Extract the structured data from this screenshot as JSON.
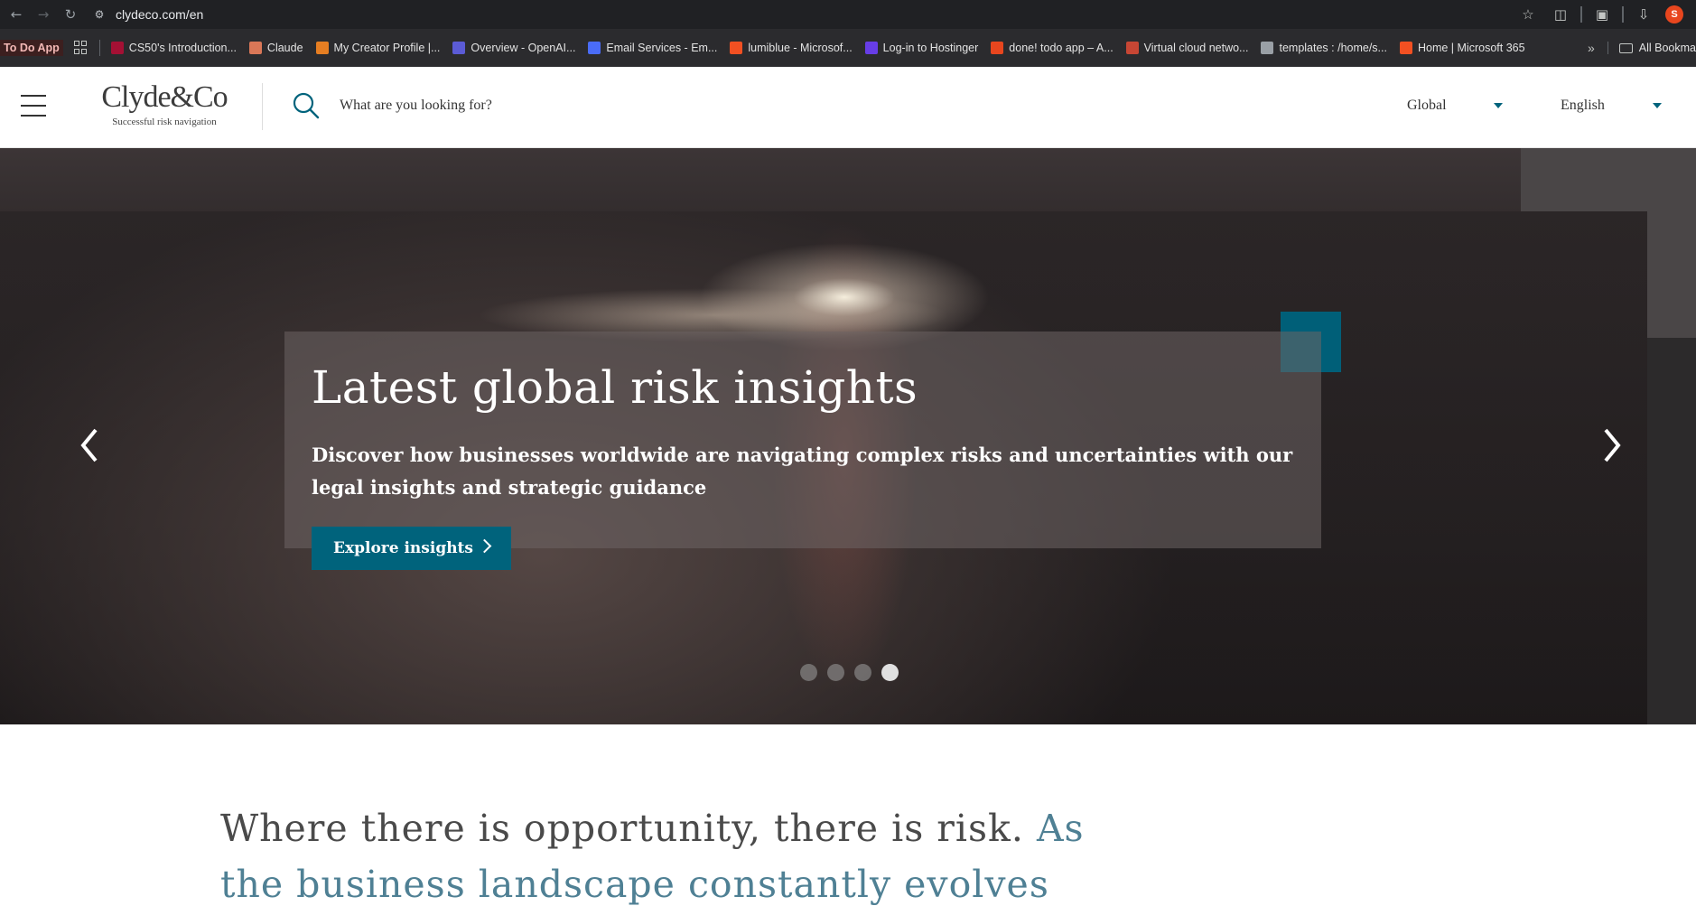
{
  "browser": {
    "url": "clydeco.com/en",
    "bookmarks": [
      {
        "label": "To Do App",
        "icon": "todo-app-icon",
        "color": "#c0392b"
      },
      {
        "label": "CS50's Introduction...",
        "icon": "cs50-icon",
        "color": "#a41034"
      },
      {
        "label": "Claude",
        "icon": "claude-icon",
        "color": "#d97757"
      },
      {
        "label": "My Creator Profile |...",
        "icon": "creator-icon",
        "color": "#e67e22"
      },
      {
        "label": "Overview - OpenAI...",
        "icon": "openai-icon",
        "color": "#5b5bd6"
      },
      {
        "label": "Email Services - Em...",
        "icon": "email-icon",
        "color": "#4a6cf7"
      },
      {
        "label": "lumiblue - Microsof...",
        "icon": "microsoft-icon",
        "color": "#f25022"
      },
      {
        "label": "Log-in to Hostinger",
        "icon": "hostinger-icon",
        "color": "#673de6"
      },
      {
        "label": "done! todo app – A...",
        "icon": "done-app-icon",
        "color": "#e8461e"
      },
      {
        "label": "Virtual cloud netwo...",
        "icon": "oracle-icon",
        "color": "#c74634"
      },
      {
        "label": "templates : /home/s...",
        "icon": "pythonanywhere-icon",
        "color": "#9aa0a6"
      },
      {
        "label": "Home | Microsoft 365",
        "icon": "microsoft365-icon",
        "color": "#f25022"
      }
    ],
    "all_bookmarks": "All Bookma",
    "avatar_initial": "S",
    "more": "»"
  },
  "header": {
    "logo_word": "Clyde&Co",
    "logo_tagline": "Successful risk navigation",
    "search_placeholder": "What are you looking for?",
    "region": "Global",
    "language": "English"
  },
  "hero": {
    "title": "Latest global risk insights",
    "description": "Discover how businesses worldwide are navigating complex risks and uncertainties with our legal insights and strategic guidance",
    "cta": "Explore insights",
    "slide_count": 4,
    "active_slide": 4,
    "accent_color": "#005f78"
  },
  "intro": {
    "text_main": "Where there is opportunity, there is risk. ",
    "text_accent": "As",
    "text_line2": "the business landscape constantly evolves"
  }
}
